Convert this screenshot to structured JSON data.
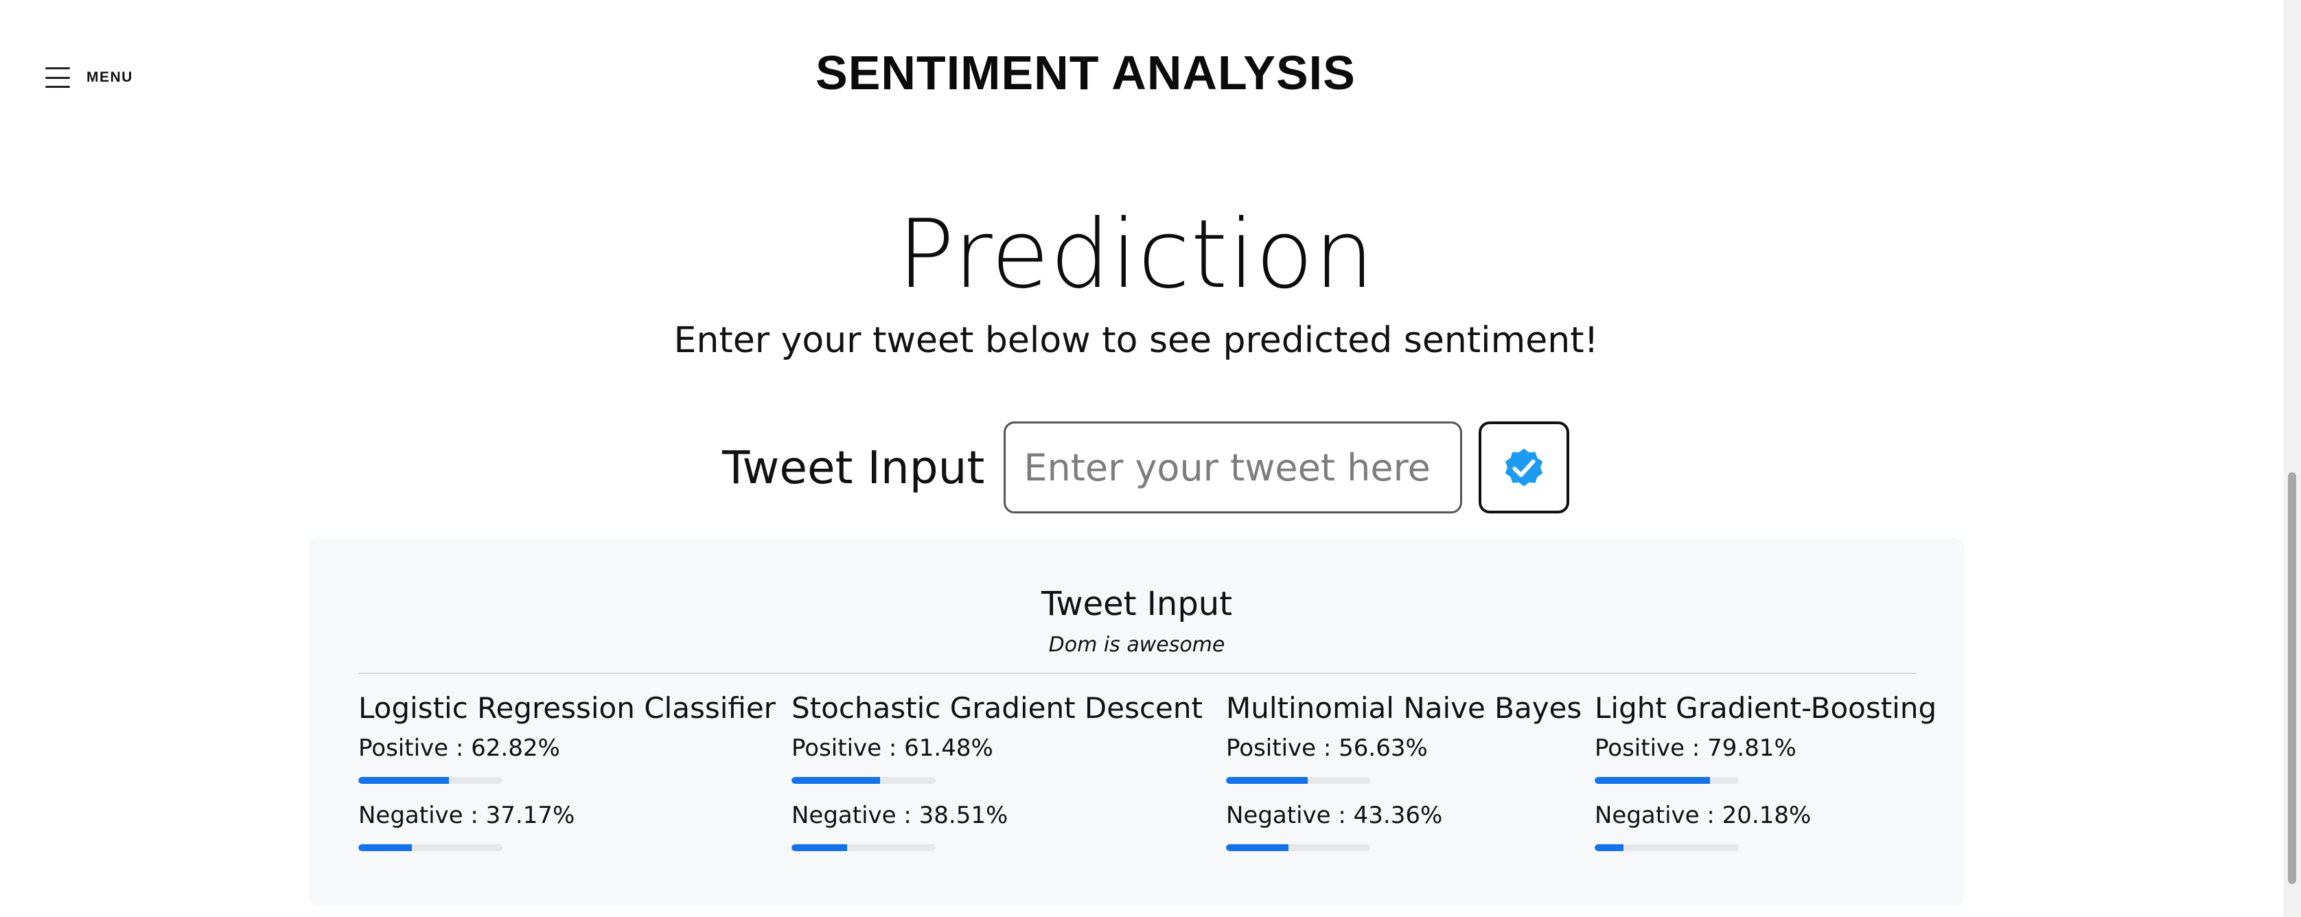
{
  "header": {
    "menu_label": "MENU",
    "site_title": "SENTIMENT ANALYSIS"
  },
  "main": {
    "headline": "Prediction",
    "subheadline": "Enter your tweet below to see predicted sentiment!",
    "input_label": "Tweet Input",
    "input_placeholder": "Enter your tweet here",
    "input_value": "",
    "submit_icon": "verified-check-icon"
  },
  "result": {
    "title": "Tweet Input",
    "tweet": "Dom is awesome",
    "models": [
      {
        "name": "Logistic Regression Classifier",
        "positive_text": "Positive : 62.82%",
        "negative_text": "Negative : 37.17%",
        "positive": 62.82,
        "negative": 37.17
      },
      {
        "name": "Stochastic Gradient Descent",
        "positive_text": "Positive : 61.48%",
        "negative_text": "Negative : 38.51%",
        "positive": 61.48,
        "negative": 38.51
      },
      {
        "name": "Multinomial Naive Bayes",
        "positive_text": "Positive : 56.63%",
        "negative_text": "Negative : 43.36%",
        "positive": 56.63,
        "negative": 43.36
      },
      {
        "name": "Light Gradient-Boosting",
        "positive_text": "Positive : 79.81%",
        "negative_text": "Negative : 20.18%",
        "positive": 79.81,
        "negative": 20.18
      }
    ]
  },
  "colors": {
    "accent": "#1572e8",
    "bar_track": "#e5e7ea",
    "card_bg": "#f7f8f9",
    "badge": "#1d9bf0"
  }
}
